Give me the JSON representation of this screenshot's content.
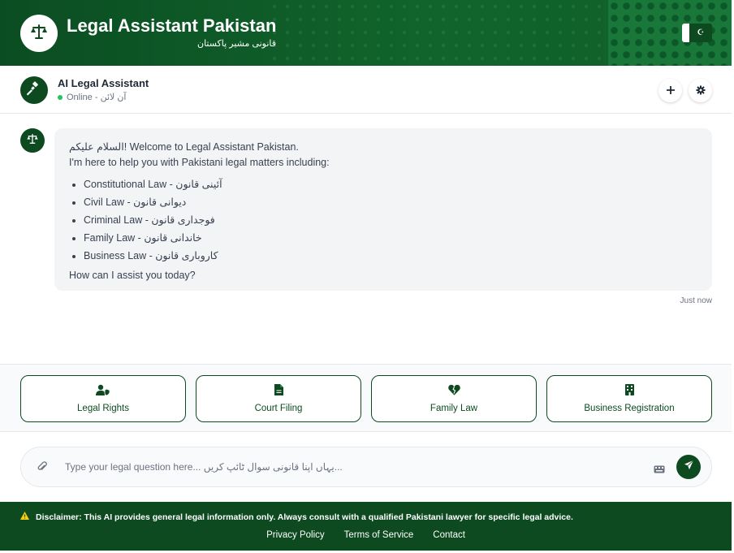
{
  "header": {
    "title": "Legal Assistant Pakistan",
    "subtitle": "قانونی مشیر پاکستان",
    "lang_toggle_icon": "crescent-star-icon"
  },
  "assistant": {
    "name": "AI Legal Assistant",
    "status": "Online - آن لائن",
    "status_color": "#22c55e",
    "new_chat_icon": "plus-icon",
    "settings_icon": "gear-icon"
  },
  "message": {
    "greeting_urdu": "السلام علیکم!",
    "greeting": " Welcome to Legal Assistant Pakistan.",
    "intro": "I'm here to help you with Pakistani legal matters including:",
    "items": [
      "Constitutional Law - آئینی قانون",
      "Civil Law - دیوانی قانون",
      "Criminal Law - فوجداری قانون",
      "Family Law - خاندانی قانون",
      "Business Law - کاروباری قانون"
    ],
    "closing": "How can I assist you today?",
    "timestamp": "Just now"
  },
  "quick_actions": [
    {
      "label": "Legal Rights",
      "icon": "user-shield-icon"
    },
    {
      "label": "Court Filing",
      "icon": "document-icon"
    },
    {
      "label": "Family Law",
      "icon": "heart-broken-icon"
    },
    {
      "label": "Business Registration",
      "icon": "building-icon"
    }
  ],
  "input": {
    "placeholder": "Type your legal question here... یہاں اپنا قانونی سوال ٹائپ کریں...",
    "attach_icon": "paperclip-icon",
    "keyboard_icon": "keyboard-icon",
    "send_icon": "send-icon"
  },
  "footer": {
    "disclaimer": "Disclaimer: This AI provides general legal information only. Always consult with a qualified Pakistani lawyer for specific legal advice.",
    "links": [
      "Privacy Policy",
      "Terms of Service",
      "Contact"
    ]
  },
  "colors": {
    "primary": "#0d4a20",
    "accent": "#11652c",
    "warning": "#facc15"
  }
}
